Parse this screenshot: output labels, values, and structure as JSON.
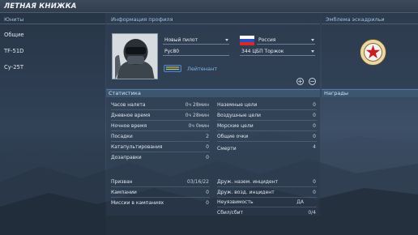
{
  "window": {
    "title": "ЛЕТНАЯ КНИЖКА"
  },
  "sidebar": {
    "header": "Юниты",
    "items": [
      {
        "label": "Общие"
      },
      {
        "label": "TF-51D"
      },
      {
        "label": "Су-25Т"
      }
    ]
  },
  "profile": {
    "header": "Информация профиля",
    "pilot_select": "Новый пилот",
    "callsign": "Рус80",
    "country": "Россия",
    "unit": "344 ЦБП Торжок",
    "rank": "Лейтенант",
    "add_label": "+",
    "remove_label": "−"
  },
  "squadron": {
    "header": "Эмблема эскадрильи"
  },
  "stats": {
    "header": "Статистика",
    "left": [
      {
        "label": "Часов налета",
        "value": "0ч 28мин"
      },
      {
        "label": "Дневное время",
        "value": "0ч 28мин"
      },
      {
        "label": "Ночное время",
        "value": "0ч 0мин"
      },
      {
        "label": "Посадки",
        "value": "2"
      },
      {
        "label": "Катапультирования",
        "value": "0"
      },
      {
        "label": "Дозаправки",
        "value": "0"
      }
    ],
    "right": [
      {
        "label": "Наземные цели",
        "value": "0"
      },
      {
        "label": "Воздушные цели",
        "value": "0"
      },
      {
        "label": "Морские цели",
        "value": "0"
      },
      {
        "label": "Общие очки",
        "value": "0"
      },
      {
        "label": "Смерти",
        "value": "4"
      }
    ],
    "left_bottom": [
      {
        "label": "Призван",
        "value": "03/16/22"
      },
      {
        "label": "Кампании",
        "value": "0"
      },
      {
        "label": "Миссии в кампаниях",
        "value": "0"
      }
    ],
    "right_bottom": [
      {
        "label": "Друж. назем. инцидент",
        "value": "0"
      },
      {
        "label": "Друж. возд. инцидент",
        "value": "0"
      },
      {
        "label": "Неуязвимость",
        "value": "ДА"
      },
      {
        "label": "Сбил/сбит",
        "value": "0/4"
      }
    ]
  },
  "awards": {
    "header": "Награды"
  }
}
